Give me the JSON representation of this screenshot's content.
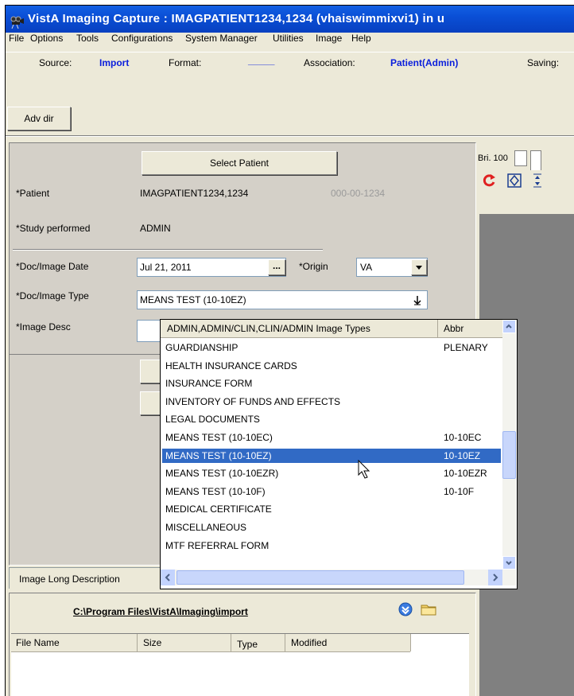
{
  "window": {
    "title": "VistA Imaging Capture : IMAGPATIENT1234,1234 (vhaiswimmixvi1)  in u"
  },
  "menu": [
    "File",
    "Options",
    "Tools",
    "Configurations",
    "System Manager",
    "Utilities",
    "Image",
    "Help"
  ],
  "toolbar": {
    "source_label": "Source:",
    "source_value": "Import",
    "format_label": "Format:",
    "format_value": "_____",
    "association_label": "Association:",
    "association_value": "Patient(Admin)",
    "saving_label": "Saving:",
    "adv_dir": "Adv dir"
  },
  "form": {
    "select_patient": "Select Patient",
    "patient_label": "*Patient",
    "patient_value": "IMAGPATIENT1234,1234",
    "ssn": "000-00-1234",
    "study_label": "*Study performed",
    "study_value": "ADMIN",
    "doc_date_label": "*Doc/Image Date",
    "doc_date_value": "Jul 21, 2011",
    "date_btn": "...",
    "origin_label": "*Origin",
    "origin_value": "VA",
    "doc_type_label": "*Doc/Image Type",
    "doc_type_value": "MEANS TEST (10-10EZ)",
    "image_desc_label": "*Image Desc",
    "long_desc_label": "Image Long Description"
  },
  "dropdown": {
    "col1": "ADMIN,ADMIN/CLIN,CLIN/ADMIN Image Types",
    "col2": "Abbr",
    "rows": [
      {
        "name": "GUARDIANSHIP",
        "abbr": "PLENARY"
      },
      {
        "name": "HEALTH INSURANCE CARDS",
        "abbr": ""
      },
      {
        "name": "INSURANCE FORM",
        "abbr": ""
      },
      {
        "name": "INVENTORY OF FUNDS AND EFFECTS",
        "abbr": ""
      },
      {
        "name": "LEGAL DOCUMENTS",
        "abbr": ""
      },
      {
        "name": "MEANS TEST (10-10EC)",
        "abbr": "10-10EC"
      },
      {
        "name": "MEANS TEST (10-10EZ)",
        "abbr": "10-10EZ"
      },
      {
        "name": "MEANS TEST (10-10EZR)",
        "abbr": "10-10EZR"
      },
      {
        "name": "MEANS TEST (10-10F)",
        "abbr": "10-10F"
      },
      {
        "name": "MEDICAL CERTIFICATE",
        "abbr": ""
      },
      {
        "name": "MISCELLANEOUS",
        "abbr": ""
      },
      {
        "name": "MTF REFERRAL FORM",
        "abbr": ""
      }
    ]
  },
  "file_panel": {
    "path": "C:\\Program Files\\VistA\\Imaging\\import",
    "cols": [
      "File Name",
      "Size",
      "Type",
      "Modified"
    ]
  },
  "right_panel": {
    "bri": "Bri. 100"
  }
}
